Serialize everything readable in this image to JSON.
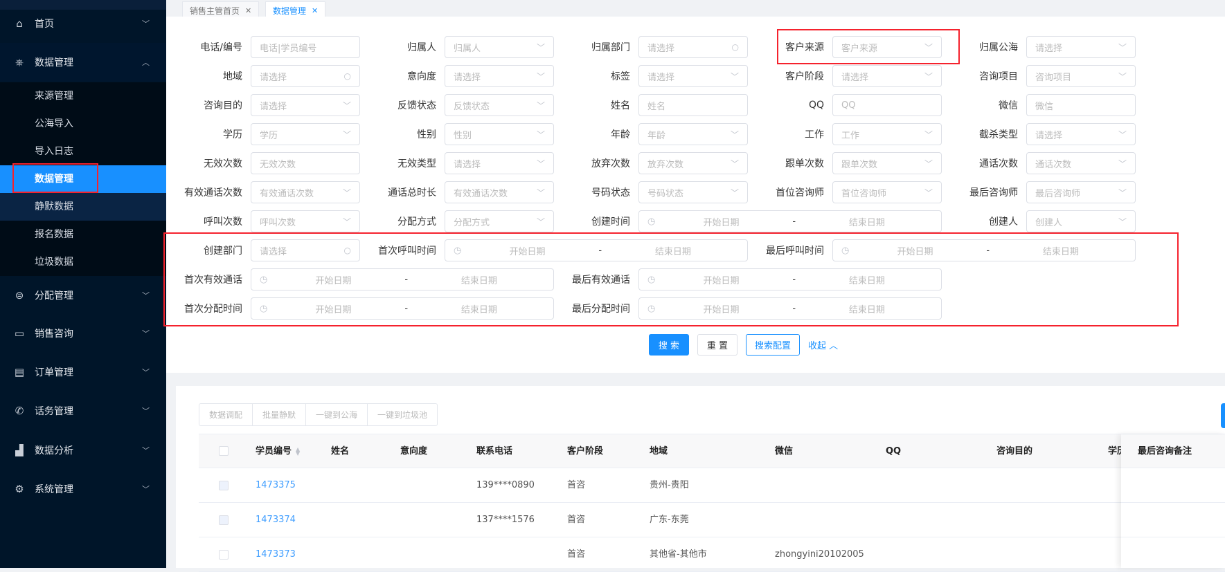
{
  "sidebar": {
    "menu": [
      {
        "label": "首页",
        "icon": "home-icon",
        "glyph": "⌂",
        "open": false
      },
      {
        "label": "数据管理",
        "icon": "database-icon",
        "glyph": "⎈",
        "open": true
      },
      {
        "label": "分配管理",
        "icon": "distribute-icon",
        "glyph": "⊜",
        "open": false
      },
      {
        "label": "销售咨询",
        "icon": "chat-icon",
        "glyph": "▭",
        "open": false
      },
      {
        "label": "订单管理",
        "icon": "order-icon",
        "glyph": "▤",
        "open": false
      },
      {
        "label": "话务管理",
        "icon": "phone-icon",
        "glyph": "✆",
        "open": false
      },
      {
        "label": "数据分析",
        "icon": "chart-icon",
        "glyph": "▟",
        "open": false
      },
      {
        "label": "系统管理",
        "icon": "gear-icon",
        "glyph": "⚙",
        "open": false
      }
    ],
    "submenu": [
      "来源管理",
      "公海导入",
      "导入日志",
      "数据管理",
      "静默数据",
      "报名数据",
      "垃圾数据"
    ],
    "active_sub": "数据管理"
  },
  "tabs": [
    {
      "label": "销售主管首页",
      "active": false
    },
    {
      "label": "数据管理",
      "active": true
    }
  ],
  "form": {
    "fields": [
      {
        "label": "电话/编号",
        "placeholder": "电话|学员编号",
        "type": "input"
      },
      {
        "label": "归属人",
        "placeholder": "归属人",
        "type": "select"
      },
      {
        "label": "归属部门",
        "placeholder": "请选择",
        "type": "search"
      },
      {
        "label": "客户来源",
        "placeholder": "客户来源",
        "type": "select"
      },
      {
        "label": "归属公海",
        "placeholder": "请选择",
        "type": "select"
      },
      {
        "label": "地域",
        "placeholder": "请选择",
        "type": "search"
      },
      {
        "label": "意向度",
        "placeholder": "请选择",
        "type": "select"
      },
      {
        "label": "标签",
        "placeholder": "请选择",
        "type": "select"
      },
      {
        "label": "客户阶段",
        "placeholder": "请选择",
        "type": "select"
      },
      {
        "label": "咨询项目",
        "placeholder": "咨询项目",
        "type": "select"
      },
      {
        "label": "咨询目的",
        "placeholder": "请选择",
        "type": "select"
      },
      {
        "label": "反馈状态",
        "placeholder": "反馈状态",
        "type": "select"
      },
      {
        "label": "姓名",
        "placeholder": "姓名",
        "type": "input"
      },
      {
        "label": "QQ",
        "placeholder": "QQ",
        "type": "input"
      },
      {
        "label": "微信",
        "placeholder": "微信",
        "type": "input"
      },
      {
        "label": "学历",
        "placeholder": "学历",
        "type": "select"
      },
      {
        "label": "性别",
        "placeholder": "性别",
        "type": "select"
      },
      {
        "label": "年龄",
        "placeholder": "年龄",
        "type": "select"
      },
      {
        "label": "工作",
        "placeholder": "工作",
        "type": "select"
      },
      {
        "label": "截杀类型",
        "placeholder": "请选择",
        "type": "select"
      },
      {
        "label": "无效次数",
        "placeholder": "无效次数",
        "type": "input"
      },
      {
        "label": "无效类型",
        "placeholder": "请选择",
        "type": "select"
      },
      {
        "label": "放弃次数",
        "placeholder": "放弃次数",
        "type": "select"
      },
      {
        "label": "跟单次数",
        "placeholder": "跟单次数",
        "type": "select"
      },
      {
        "label": "通话次数",
        "placeholder": "通话次数",
        "type": "select"
      },
      {
        "label": "有效通话次数",
        "placeholder": "有效通话次数",
        "type": "select"
      },
      {
        "label": "通话总时长",
        "placeholder": "有效通话次数",
        "type": "select"
      },
      {
        "label": "号码状态",
        "placeholder": "号码状态",
        "type": "select"
      },
      {
        "label": "首位咨询师",
        "placeholder": "首位咨询师",
        "type": "select"
      },
      {
        "label": "最后咨询师",
        "placeholder": "最后咨询师",
        "type": "select"
      },
      {
        "label": "呼叫次数",
        "placeholder": "呼叫次数",
        "type": "select"
      },
      {
        "label": "分配方式",
        "placeholder": "分配方式",
        "type": "select"
      },
      {
        "label": "创建时间",
        "type": "daterange",
        "start": "开始日期",
        "end": "结束日期",
        "sep": "-"
      },
      {
        "label": "创建人",
        "placeholder": "创建人",
        "type": "select"
      },
      {
        "label": "创建部门",
        "placeholder": "请选择",
        "type": "search"
      },
      {
        "label": "首次呼叫时间",
        "type": "daterange",
        "start": "开始日期",
        "end": "结束日期",
        "sep": "-"
      },
      {
        "label": "最后呼叫时间",
        "type": "daterange",
        "start": "开始日期",
        "end": "结束日期",
        "sep": "-"
      },
      {
        "label": "首次有效通话",
        "type": "daterange",
        "start": "开始日期",
        "end": "结束日期",
        "sep": "-"
      },
      {
        "label": "最后有效通话",
        "type": "daterange",
        "start": "开始日期",
        "end": "结束日期",
        "sep": "-"
      },
      {
        "label": "首次分配时间",
        "type": "daterange",
        "start": "开始日期",
        "end": "结束日期",
        "sep": "-"
      },
      {
        "label": "最后分配时间",
        "type": "daterange",
        "start": "开始日期",
        "end": "结束日期",
        "sep": "-"
      }
    ],
    "buttons": {
      "search": "搜 索",
      "reset": "重 置",
      "config": "搜索配置",
      "collapse": "收起 ︿"
    }
  },
  "toolbar": [
    "数据调配",
    "批量静默",
    "一键到公海",
    "一键到垃圾池"
  ],
  "table": {
    "columns": [
      "学员编号",
      "姓名",
      "意向度",
      "联系电话",
      "客户阶段",
      "地域",
      "微信",
      "QQ",
      "咨询目的",
      "学历"
    ],
    "fixed_column": "最后咨询备注",
    "rows": [
      {
        "id": "1473375",
        "name": "",
        "intent": "",
        "phone": "139****0890",
        "stage": "首咨",
        "region": "贵州-贵阳",
        "wechat": "",
        "qq": "",
        "purpose": "",
        "edu": ""
      },
      {
        "id": "1473374",
        "name": "",
        "intent": "",
        "phone": "137****1576",
        "stage": "首咨",
        "region": "广东-东莞",
        "wechat": "",
        "qq": "",
        "purpose": "",
        "edu": ""
      },
      {
        "id": "1473373",
        "name": "",
        "intent": "",
        "phone": "",
        "stage": "首咨",
        "region": "其他省-其他市",
        "wechat": "zhongyini20102005",
        "qq": "",
        "purpose": "",
        "edu": ""
      }
    ]
  },
  "colors": {
    "accent": "#1890ff",
    "sidebar": "#001529",
    "annotation": "#f5222d"
  }
}
